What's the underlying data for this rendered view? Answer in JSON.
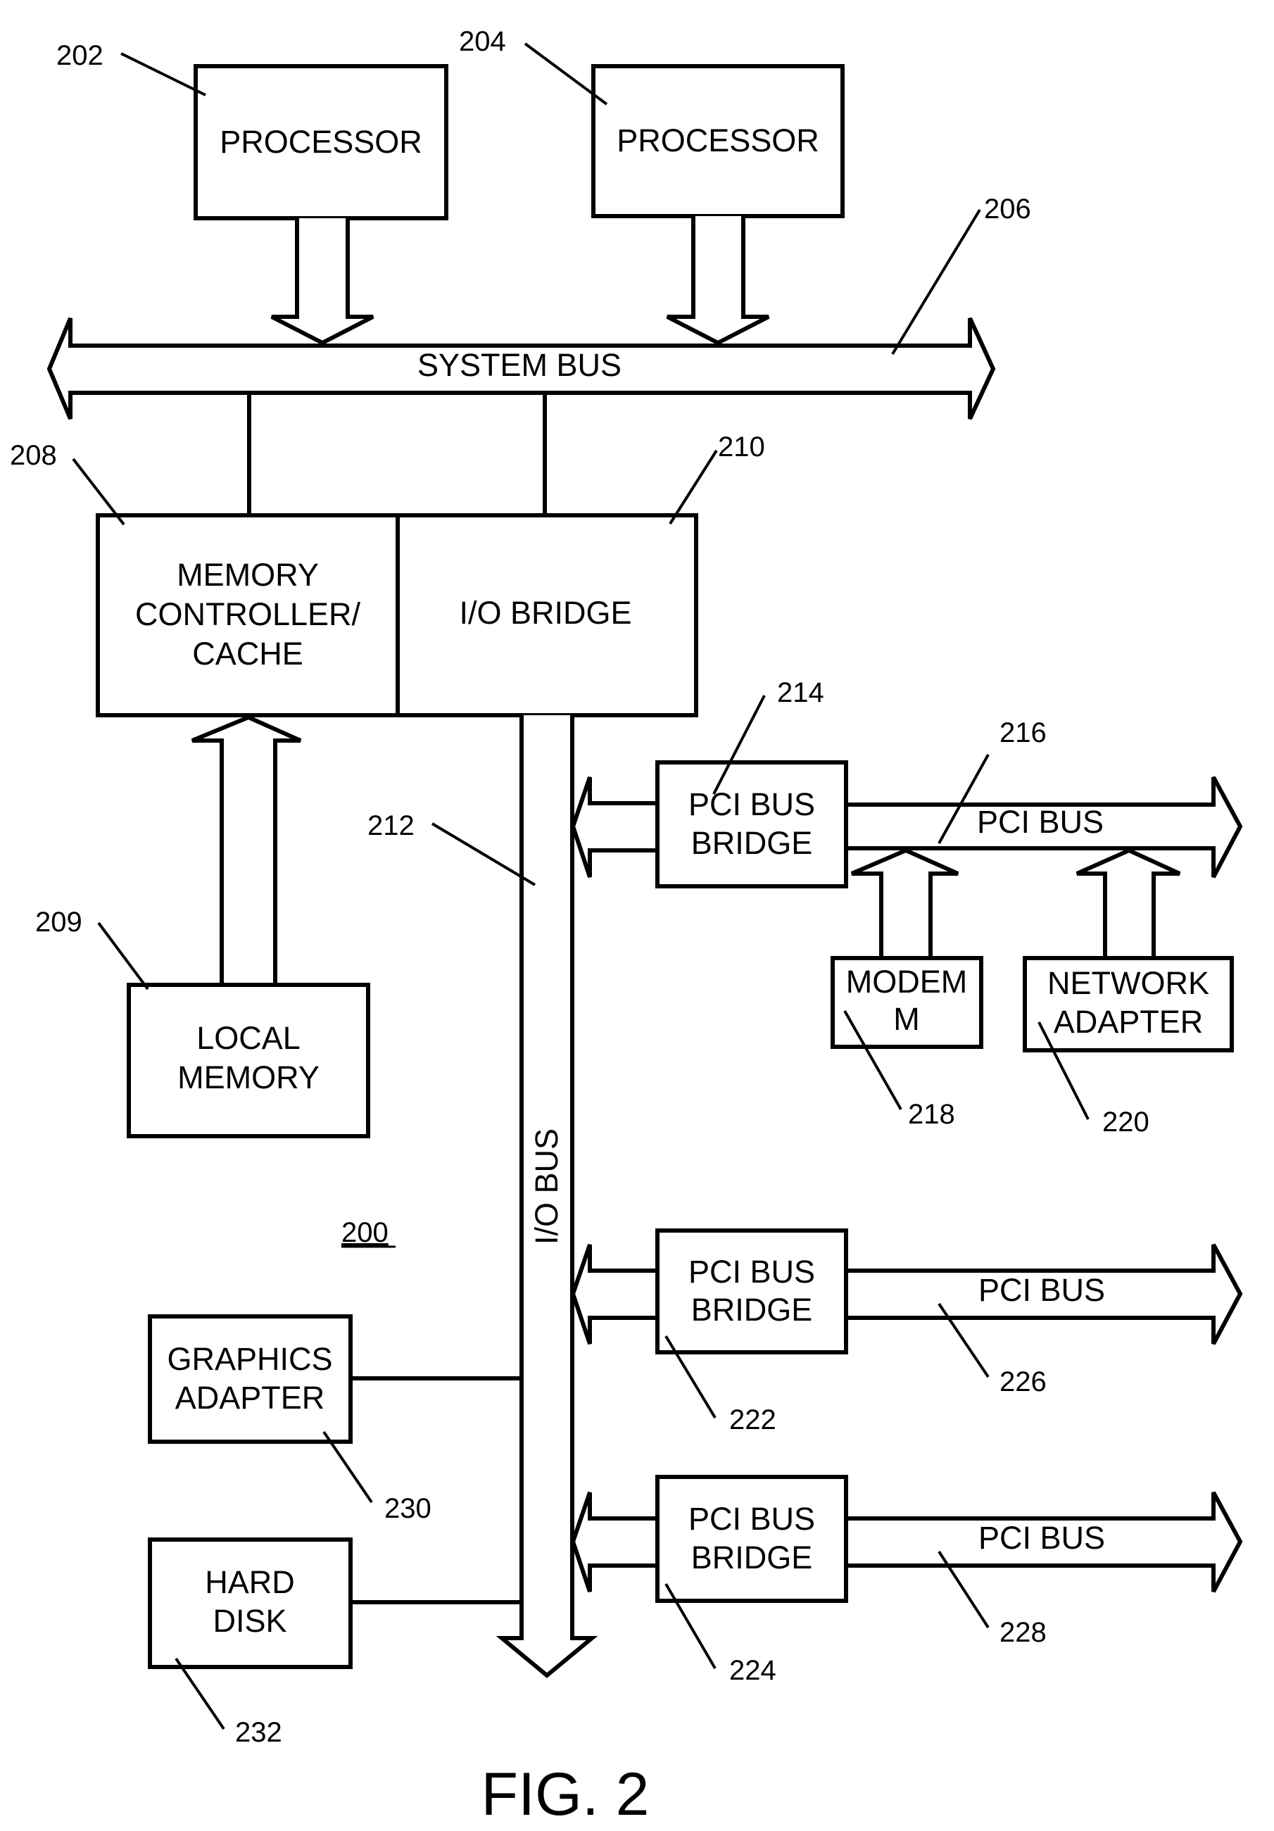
{
  "figure": {
    "title": "FIG. 2",
    "system_ref": "200"
  },
  "components": {
    "processor_a": {
      "label": "PROCESSOR",
      "ref": "202"
    },
    "processor_b": {
      "label": "PROCESSOR",
      "ref": "204"
    },
    "system_bus": {
      "label": "SYSTEM BUS",
      "ref": "206"
    },
    "memory_controller": {
      "lines": [
        "MEMORY",
        "CONTROLLER/",
        "CACHE"
      ],
      "ref": "208"
    },
    "local_memory": {
      "lines": [
        "LOCAL",
        "MEMORY"
      ],
      "ref": "209"
    },
    "io_bridge": {
      "label": "I/O BRIDGE",
      "ref": "210"
    },
    "io_bus": {
      "label": "I/O BUS",
      "ref": "212"
    },
    "pci_bridge_1": {
      "lines": [
        "PCI BUS",
        "BRIDGE"
      ],
      "ref": "214"
    },
    "pci_bus_1": {
      "label": "PCI BUS",
      "ref": "216"
    },
    "modem": {
      "lines": [
        "MODEM",
        "M"
      ],
      "ref": "218"
    },
    "network_adapter": {
      "lines": [
        "NETWORK",
        "ADAPTER"
      ],
      "ref": "220"
    },
    "pci_bridge_2": {
      "lines": [
        "PCI BUS",
        "BRIDGE"
      ],
      "ref": "222"
    },
    "pci_bridge_3": {
      "lines": [
        "PCI BUS",
        "BRIDGE"
      ],
      "ref": "224"
    },
    "pci_bus_2": {
      "label": "PCI BUS",
      "ref": "226"
    },
    "pci_bus_3": {
      "label": "PCI BUS",
      "ref": "228"
    },
    "graphics_adapter": {
      "lines": [
        "GRAPHICS",
        "ADAPTER"
      ],
      "ref": "230"
    },
    "hard_disk": {
      "lines": [
        "HARD",
        "DISK"
      ],
      "ref": "232"
    }
  }
}
